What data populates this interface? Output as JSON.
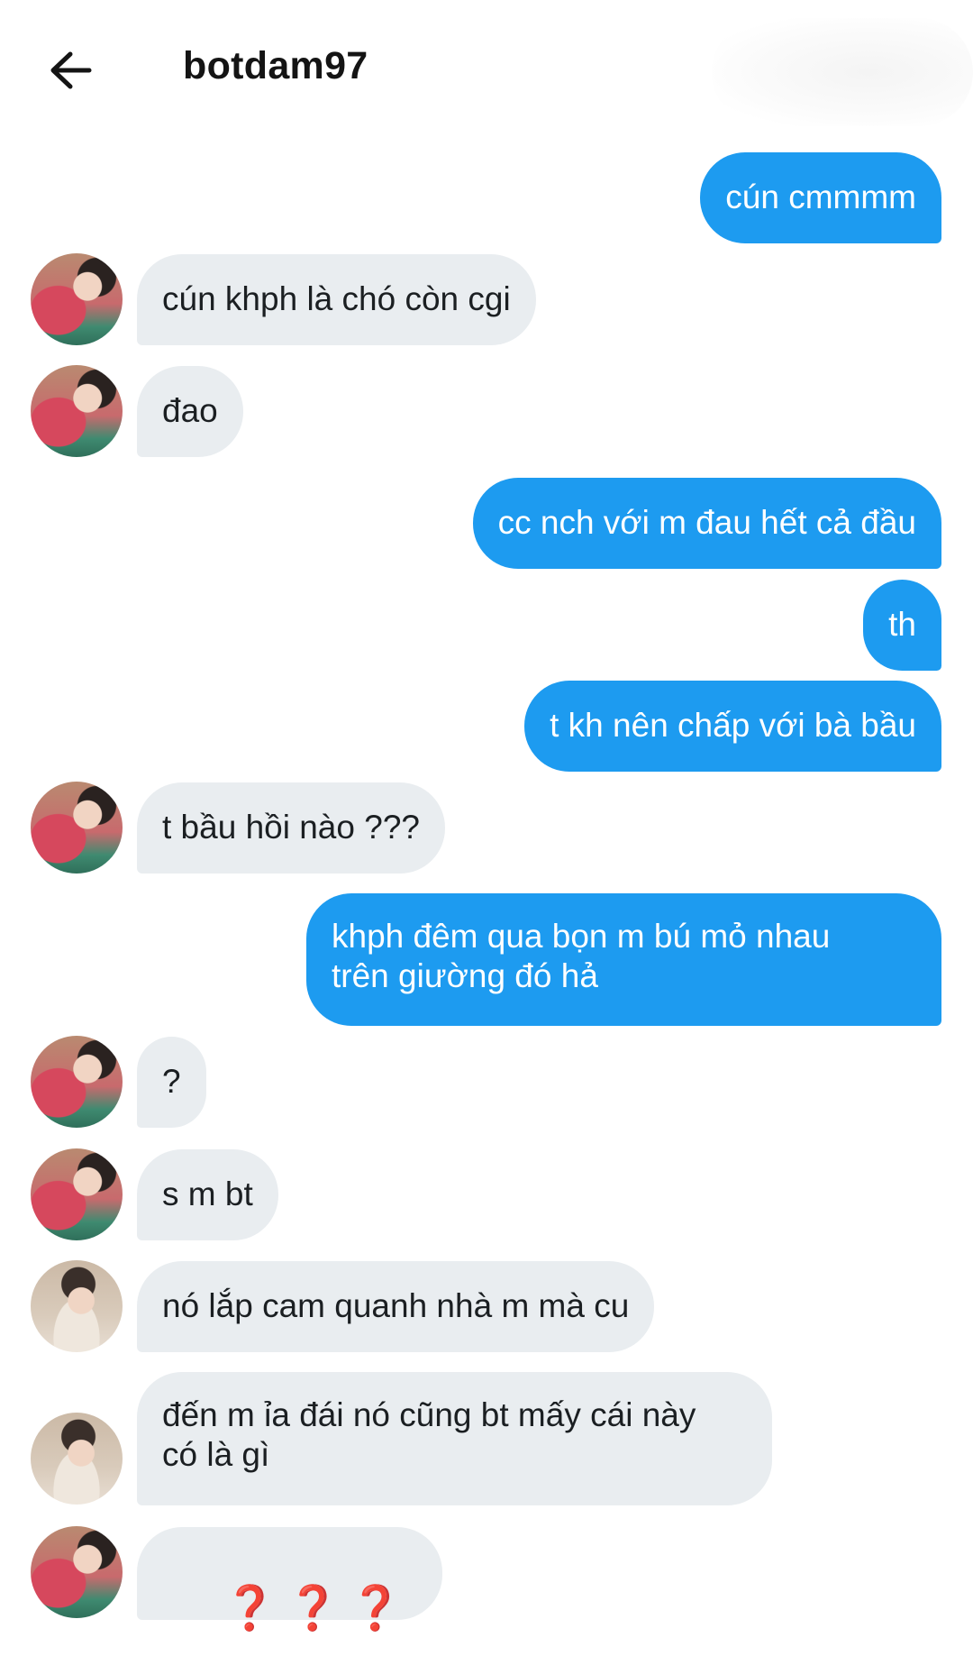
{
  "header": {
    "title": "botdam97",
    "back_icon": "arrow-left-icon"
  },
  "colors": {
    "sent_bubble": "#1d9bf0",
    "received_bubble": "#e9edf0",
    "question_marks": "#d22b2b"
  },
  "messages": [
    {
      "direction": "sent",
      "text": "cún cmmmm"
    },
    {
      "direction": "received",
      "text": "cún khph là chó còn cgi"
    },
    {
      "direction": "received",
      "text": "đao"
    },
    {
      "direction": "sent",
      "text": "cc nch với m đau hết cả đầu"
    },
    {
      "direction": "sent",
      "text": "th"
    },
    {
      "direction": "sent",
      "text": "t kh nên chấp với bà bầu"
    },
    {
      "direction": "received",
      "text": "t bầu hồi nào ???"
    },
    {
      "direction": "sent",
      "text": "khph đêm qua bọn m bú mỏ nhau\ntrên giường đó hả"
    },
    {
      "direction": "received",
      "text": "?"
    },
    {
      "direction": "received",
      "text": "s m bt"
    },
    {
      "direction": "received",
      "text": "nó lắp cam quanh nhà m mà cu"
    },
    {
      "direction": "received",
      "text": "đến m ỉa đái nó cũng bt mấy cái này\ncó là gì"
    },
    {
      "direction": "received",
      "text": "❓❓❓"
    }
  ]
}
